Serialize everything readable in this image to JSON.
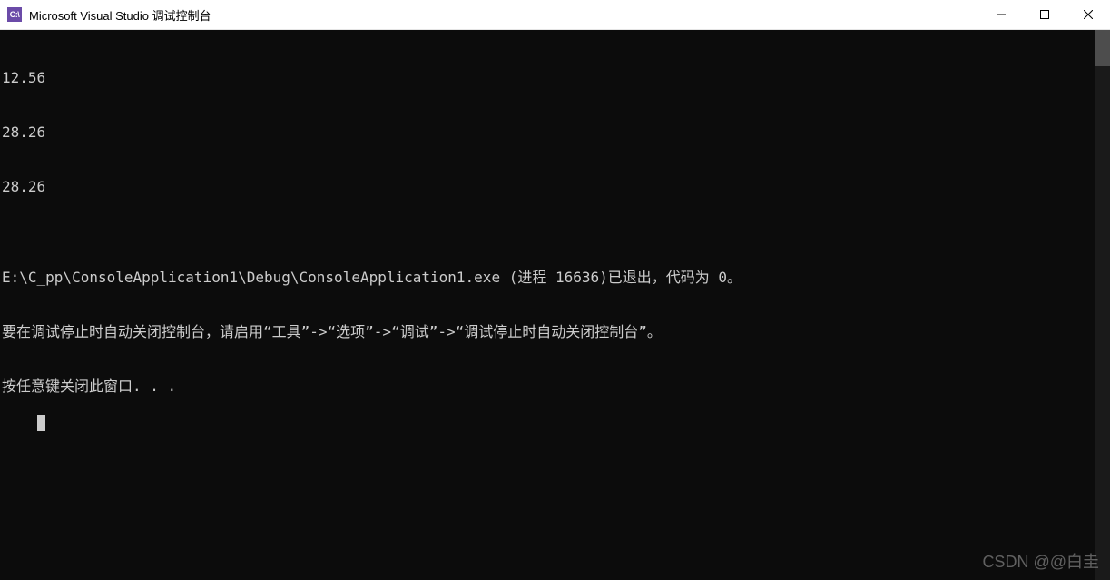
{
  "window": {
    "icon_text": "C:\\",
    "title": "Microsoft Visual Studio 调试控制台"
  },
  "console": {
    "lines": [
      "12.56",
      "28.26",
      "28.26",
      "",
      "E:\\C_pp\\ConsoleApplication1\\Debug\\ConsoleApplication1.exe (进程 16636)已退出，代码为 0。",
      "要在调试停止时自动关闭控制台，请启用“工具”->“选项”->“调试”->“调试停止时自动关闭控制台”。",
      "按任意键关闭此窗口. . ."
    ]
  },
  "watermark": "CSDN @@白圭"
}
